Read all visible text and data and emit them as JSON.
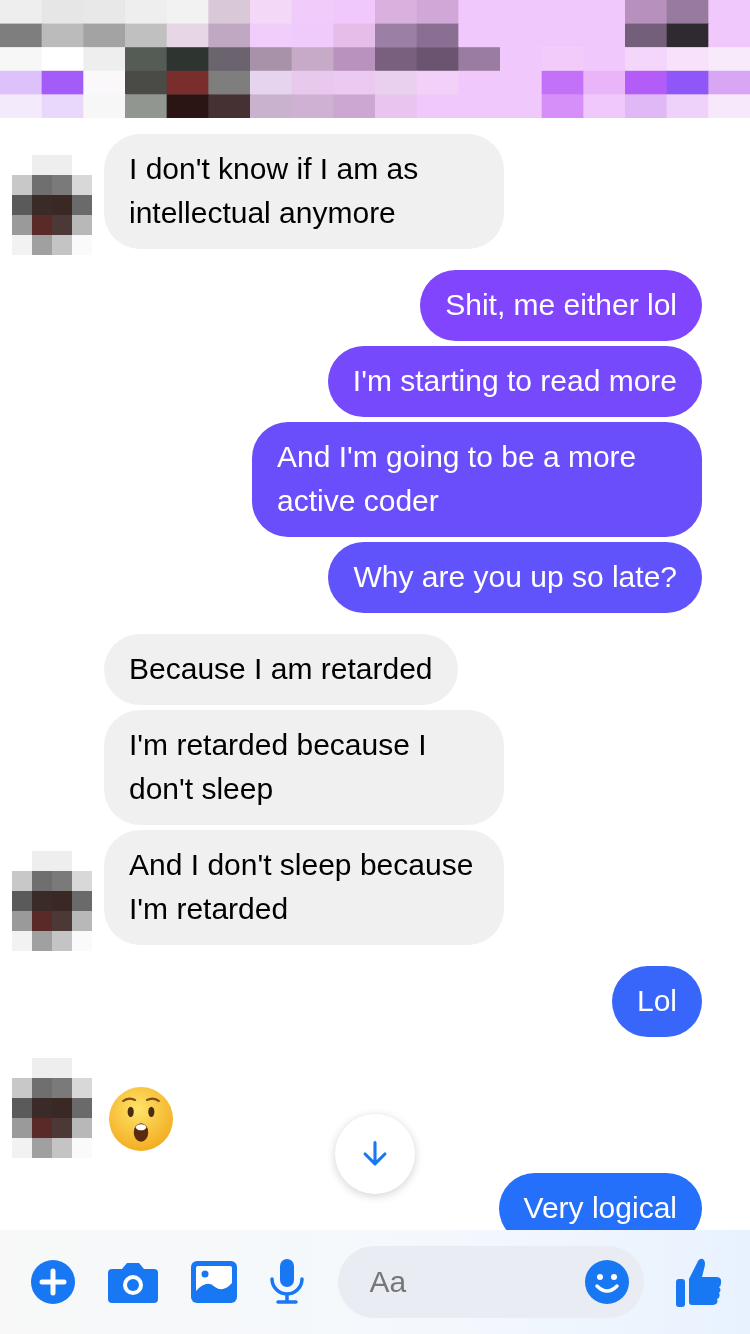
{
  "messages": [
    {
      "kind": "incoming-text",
      "text": "I don't know if I am as intellectual anymore",
      "avatar": true
    },
    {
      "kind": "outgoing-text",
      "text": "Shit, me either lol"
    },
    {
      "kind": "outgoing-text",
      "text": "I'm starting to read more"
    },
    {
      "kind": "outgoing-text",
      "text": "And I'm going to be a more active coder"
    },
    {
      "kind": "outgoing-text",
      "text": "Why are you up so late?"
    },
    {
      "kind": "incoming-text",
      "text": "Because I am retarded",
      "avatar": false
    },
    {
      "kind": "incoming-text",
      "text": "I'm retarded because I don't sleep",
      "avatar": false
    },
    {
      "kind": "incoming-text",
      "text": "And I don't sleep because I'm retarded",
      "avatar": true
    },
    {
      "kind": "outgoing-text",
      "text": "Lol"
    },
    {
      "kind": "incoming-emoji",
      "avatar": true
    },
    {
      "kind": "outgoing-text",
      "text": "Very logical"
    }
  ],
  "composer": {
    "placeholder": "Aa"
  }
}
